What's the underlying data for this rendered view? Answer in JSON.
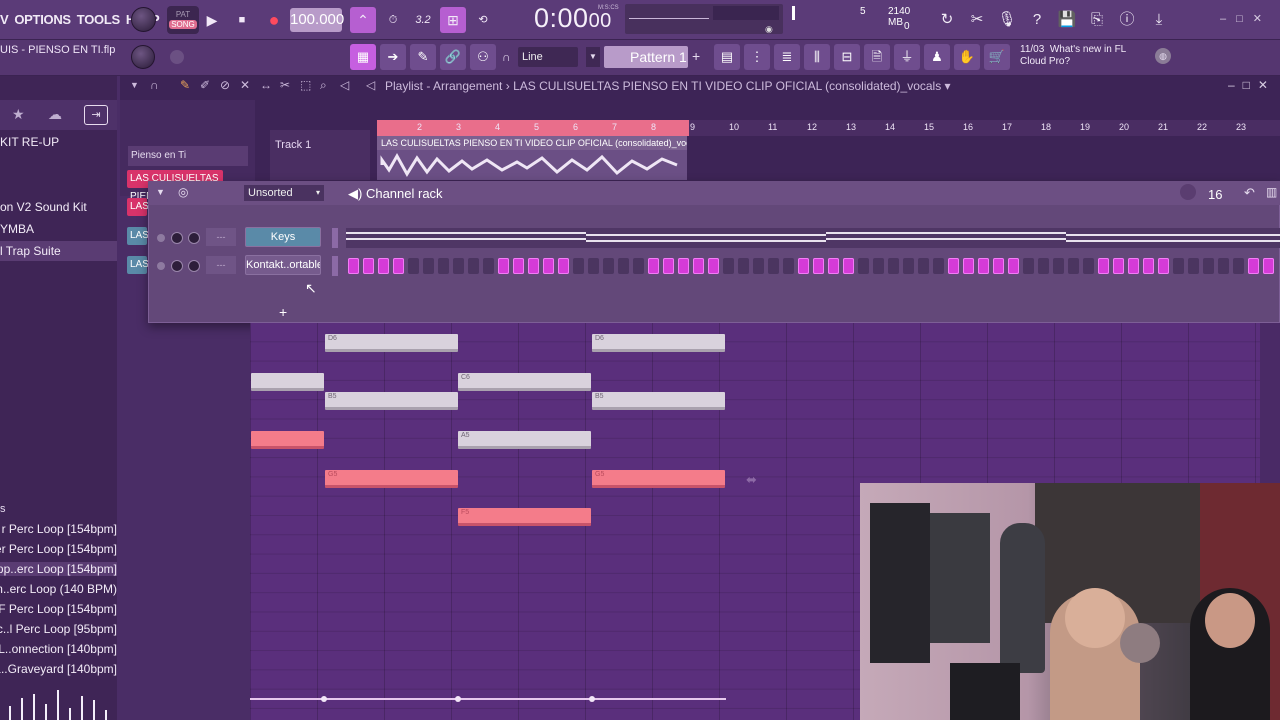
{
  "menu": {
    "items": [
      "V",
      "OPTIONS",
      "TOOLS",
      "HELP"
    ]
  },
  "transport": {
    "pat_label": "PAT",
    "song_label": "SONG",
    "tempo": "100.000",
    "time": "0:00",
    "time_frames": "00",
    "time_label": "M:S:CS"
  },
  "monitor": {
    "cpu_value": "5",
    "memory": "2140 MB",
    "poly_value": "0"
  },
  "toolbar2": {
    "filename": "UIS - PIENSO EN TI.flp",
    "snap": "Line",
    "pattern": "Pattern 1",
    "news_date": "11/03",
    "news_title": "What's new in FL",
    "news_sub": "Cloud Pro?"
  },
  "browser": {
    "items": [
      {
        "label": "KIT RE-UP",
        "selected": false
      },
      {
        "label": "on V2 Sound Kit",
        "selected": false
      },
      {
        "label": "YMBA",
        "selected": false
      },
      {
        "label": "l Trap Suite",
        "selected": true
      }
    ],
    "loop_items": [
      {
        "label": "r Perc Loop [154bpm]",
        "selected": false
      },
      {
        "label": "ver Perc Loop [154bpm]",
        "selected": false
      },
      {
        "label": "pp..erc Loop [154bpm]",
        "selected": true
      },
      {
        "label": "on..erc Loop (140 BPM)",
        "selected": false
      },
      {
        "label": "F Perc Loop [154bpm]",
        "selected": false
      },
      {
        "label": "Sc..l Perc Loop [95bpm]",
        "selected": false
      },
      {
        "label": "L..onnection [140bpm]",
        "selected": false
      },
      {
        "label": "L..Graveyard [140bpm]",
        "selected": false
      }
    ]
  },
  "playlist": {
    "title": "Playlist - Arrangement",
    "project": "LAS CULISUELTAS PIENSO EN TI VIDEO CLIP OFICIAL (consolidated)_vocals",
    "pattern_picker": "Pienso en Ti",
    "track_name": "Track 1",
    "clip_label": "LAS CULISUELTAS PIENSO EN TI VIDEO CLIP OFICIAL (consolidated)_vocals",
    "track_buttons": [
      "LAS CULISUELTAS PIEN",
      "LAS",
      "LAS",
      "LAS"
    ],
    "ruler_ticks": [
      "2",
      "3",
      "4",
      "5",
      "6",
      "7",
      "8",
      "9",
      "10",
      "11",
      "12",
      "13",
      "14",
      "15",
      "16",
      "17",
      "18",
      "19",
      "20",
      "21",
      "22",
      "23"
    ]
  },
  "channel_rack": {
    "title": "Channel rack",
    "filter": "Unsorted",
    "steps": "16",
    "channels": [
      {
        "name": "Keys",
        "selected": true
      },
      {
        "name": "Kontakt..ortable",
        "selected": false
      }
    ],
    "step_pattern": [
      1,
      1,
      1,
      1,
      0,
      0,
      0,
      0,
      0,
      0,
      1,
      1,
      1,
      1,
      1,
      0,
      0,
      0,
      0,
      0,
      1,
      1,
      1,
      1,
      1,
      0,
      0,
      0,
      0,
      0,
      1,
      1,
      1,
      1,
      0,
      0,
      0,
      0,
      0,
      0,
      1,
      1,
      1,
      1,
      1,
      0,
      0,
      0,
      0,
      0,
      1,
      1,
      1,
      1,
      1,
      0,
      0,
      0,
      0,
      0,
      1,
      1,
      1,
      1,
      1,
      0,
      0,
      0,
      0,
      0,
      1,
      1,
      1,
      1,
      1,
      0,
      0,
      0,
      0,
      0,
      1,
      1,
      1,
      1,
      1,
      0,
      0,
      0,
      0,
      0,
      1,
      1,
      1,
      1,
      0
    ]
  },
  "piano_roll": {
    "notes": [
      {
        "label": "D6",
        "kind": "w"
      },
      {
        "label": "D6",
        "kind": "w"
      },
      {
        "label": "",
        "kind": "w"
      },
      {
        "label": "C6",
        "kind": "w"
      },
      {
        "label": "B5",
        "kind": "w"
      },
      {
        "label": "B5",
        "kind": "w"
      },
      {
        "label": "",
        "kind": "p"
      },
      {
        "label": "A5",
        "kind": "w"
      },
      {
        "label": "G5",
        "kind": "p"
      },
      {
        "label": "G5",
        "kind": "p"
      },
      {
        "label": "F5",
        "kind": "p"
      }
    ]
  },
  "colors": {
    "accent_pink": "#d53bd8",
    "loop_bar": "#e96e8b",
    "note_white": "#d9d2dd",
    "note_pink": "#f47c8a"
  }
}
